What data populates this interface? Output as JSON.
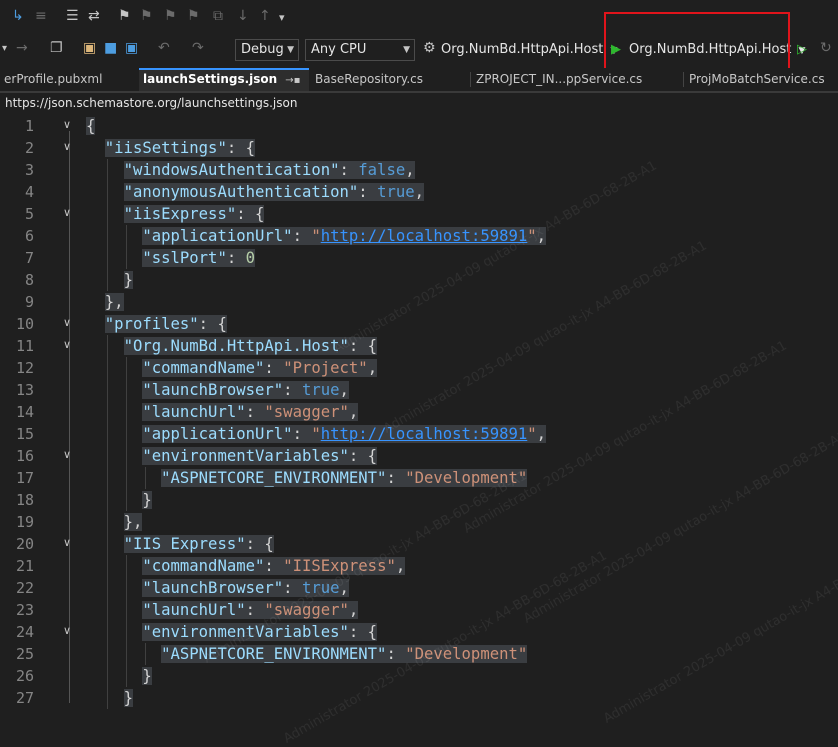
{
  "toolbar": {
    "config": "Debug",
    "platform": "Any CPU",
    "startup_project": "Org.NumBd.HttpApi.Host",
    "run_target": "Org.NumBd.HttpApi.Host"
  },
  "tabs": [
    {
      "label": "erProfile.pubxml"
    },
    {
      "label": "launchSettings.json",
      "active": true
    },
    {
      "label": "BaseRepository.cs"
    },
    {
      "label": "ZPROJECT_IN...ppService.cs"
    },
    {
      "label": "ProjMoBatchService.cs"
    }
  ],
  "schema_url": "https://json.schemastore.org/launchsettings.json",
  "colors": {
    "highlight_box": "#e0141b",
    "run_icon": "#2eb82e"
  },
  "editor": {
    "line_numbers": [
      "1",
      "2",
      "3",
      "4",
      "5",
      "6",
      "7",
      "8",
      "9",
      "10",
      "11",
      "12",
      "13",
      "14",
      "15",
      "16",
      "17",
      "18",
      "19",
      "20",
      "21",
      "22",
      "23",
      "24",
      "25",
      "26",
      "27"
    ],
    "lines": [
      {
        "open": "{"
      },
      {
        "key": "\"iisSettings\"",
        "sep": ": ",
        "open": "{"
      },
      {
        "key": "\"windowsAuthentication\"",
        "sep": ": ",
        "bool": "false",
        "tail": ","
      },
      {
        "key": "\"anonymousAuthentication\"",
        "sep": ": ",
        "bool": "true",
        "tail": ","
      },
      {
        "key": "\"iisExpress\"",
        "sep": ": ",
        "open": "{"
      },
      {
        "key": "\"applicationUrl\"",
        "sep": ": ",
        "q1": "\"",
        "url": "http://localhost:59891",
        "q2": "\"",
        "tail": ","
      },
      {
        "key": "\"sslPort\"",
        "sep": ": ",
        "num": "0"
      },
      {
        "open": "}"
      },
      {
        "open": "},"
      },
      {
        "key": "\"profiles\"",
        "sep": ": ",
        "open": "{"
      },
      {
        "key": "\"Org.NumBd.HttpApi.Host\"",
        "sep": ": ",
        "open": "{"
      },
      {
        "key": "\"commandName\"",
        "sep": ": ",
        "str": "\"Project\"",
        "tail": ","
      },
      {
        "key": "\"launchBrowser\"",
        "sep": ": ",
        "bool": "true",
        "tail": ","
      },
      {
        "key": "\"launchUrl\"",
        "sep": ": ",
        "str": "\"swagger\"",
        "tail": ","
      },
      {
        "key": "\"applicationUrl\"",
        "sep": ": ",
        "q1": "\"",
        "url": "http://localhost:59891",
        "q2": "\"",
        "tail": ","
      },
      {
        "key": "\"environmentVariables\"",
        "sep": ": ",
        "open": "{"
      },
      {
        "key": "\"ASPNETCORE_ENVIRONMENT\"",
        "sep": ": ",
        "str": "\"Development\""
      },
      {
        "open": "}"
      },
      {
        "open": "},"
      },
      {
        "key": "\"IIS Express\"",
        "sep": ": ",
        "open": "{"
      },
      {
        "key": "\"commandName\"",
        "sep": ": ",
        "str": "\"IISExpress\"",
        "tail": ","
      },
      {
        "key": "\"launchBrowser\"",
        "sep": ": ",
        "bool": "true",
        "tail": ","
      },
      {
        "key": "\"launchUrl\"",
        "sep": ": ",
        "str": "\"swagger\"",
        "tail": ","
      },
      {
        "key": "\"environmentVariables\"",
        "sep": ": ",
        "open": "{"
      },
      {
        "key": "\"ASPNETCORE_ENVIRONMENT\"",
        "sep": ": ",
        "str": "\"Development\""
      },
      {
        "open": "}"
      },
      {
        "open": "}"
      }
    ]
  },
  "watermark": {
    "lines": [
      "Administrator 2025-04-09 qutao-it-jx A4-BB-6D-68-2B-A1"
    ]
  }
}
